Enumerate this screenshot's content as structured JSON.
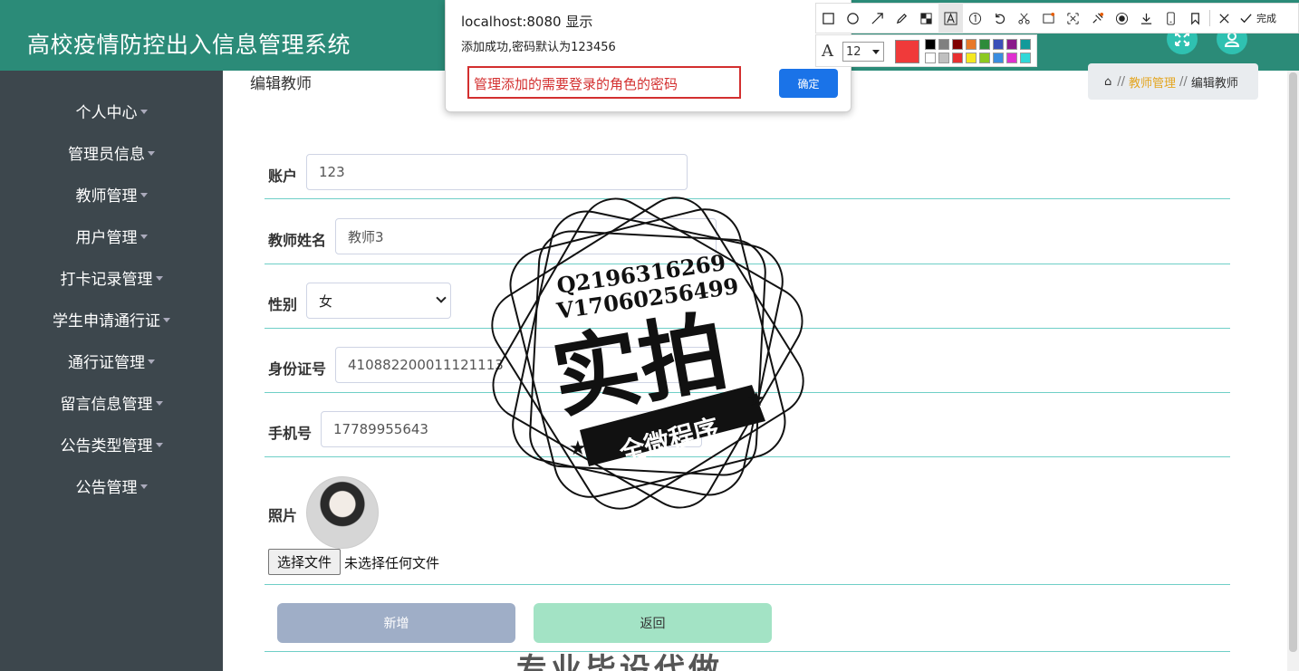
{
  "app": {
    "title": "高校疫情防控出入信息管理系统"
  },
  "header": {
    "fullscreen_icon": "expand-icon",
    "user_icon": "user-icon"
  },
  "sidebar": {
    "items": [
      {
        "label": "个人中心"
      },
      {
        "label": "管理员信息"
      },
      {
        "label": "教师管理"
      },
      {
        "label": "用户管理"
      },
      {
        "label": "打卡记录管理"
      },
      {
        "label": "学生申请通行证"
      },
      {
        "label": "通行证管理"
      },
      {
        "label": "留言信息管理"
      },
      {
        "label": "公告类型管理"
      },
      {
        "label": "公告管理"
      }
    ]
  },
  "page": {
    "title": "编辑教师",
    "breadcrumb": {
      "sep": "//",
      "items": [
        "教师管理",
        "编辑教师"
      ]
    }
  },
  "form": {
    "account_label": "账户",
    "account_value": "123",
    "name_label": "教师姓名",
    "name_value": "教师3",
    "gender_label": "性别",
    "gender_value": "女",
    "idcard_label": "身份证号",
    "idcard_value": "410882200011121113",
    "phone_label": "手机号",
    "phone_value": "17789955643",
    "photo_label": "照片",
    "file_button": "选择文件",
    "file_status": "未选择任何文件",
    "submit_label": "新增",
    "back_label": "返回"
  },
  "dialog": {
    "title": "localhost:8080 显示",
    "message": "添加成功,密码默认为123456",
    "ok_label": "确定",
    "annotation": "管理添加的需要登录的角色的密码"
  },
  "toolbar": {
    "font_size": "12",
    "done_label": "完成",
    "current_color": "#f03a3a"
  },
  "watermark": {
    "line1": "Q2196316269",
    "line2": "V17060256499",
    "big": "实拍",
    "ribbon": "全微程序",
    "bottom": "专业毕设代做"
  },
  "colors": {
    "header": "#2b8b78",
    "sidebar": "#3d474d",
    "accent": "#6fcfc7",
    "submit": "#9faec7",
    "back": "#a3e3c5"
  }
}
